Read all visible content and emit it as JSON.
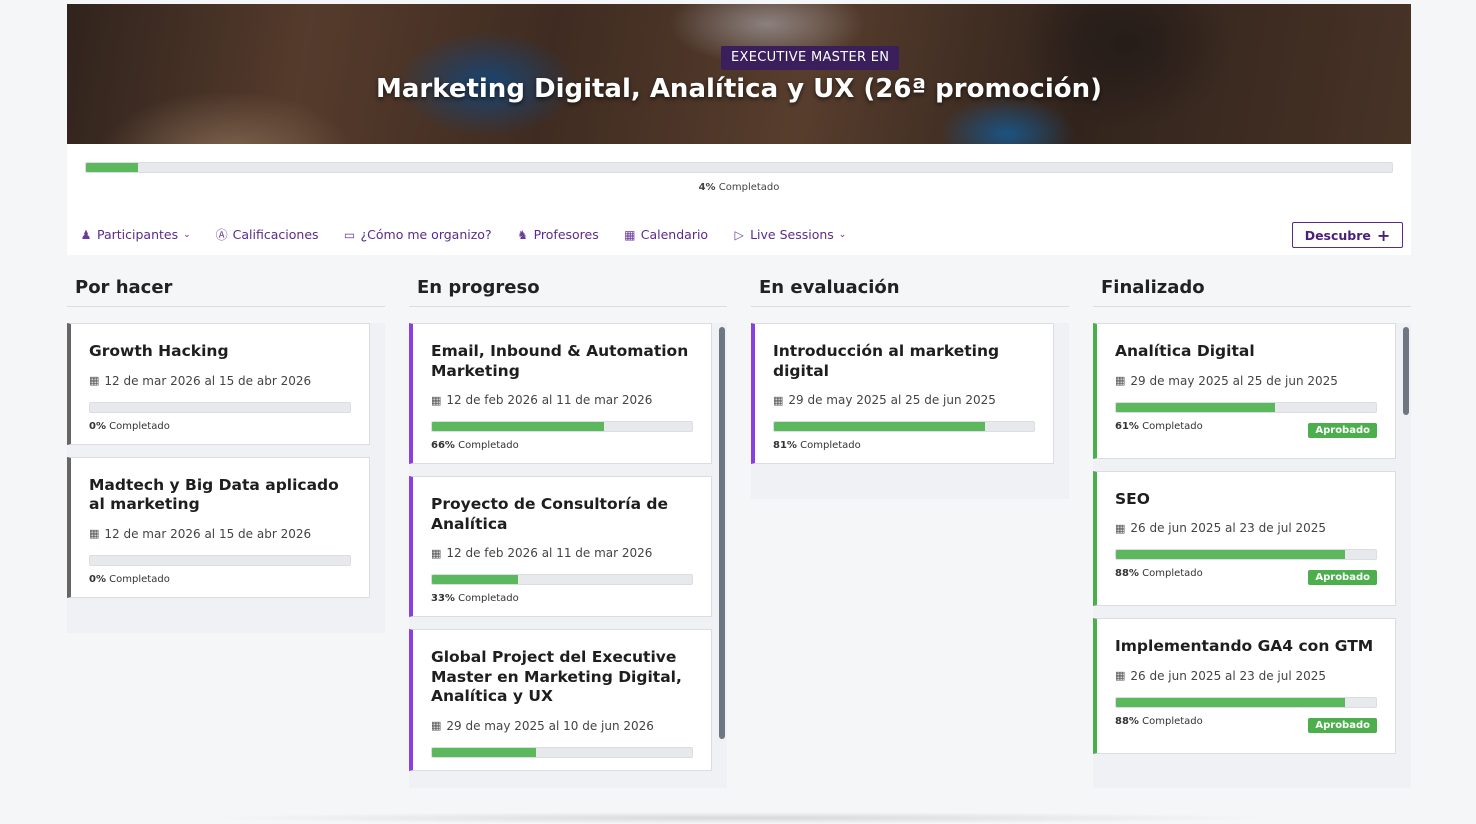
{
  "hero": {
    "badge": "EXECUTIVE MASTER EN",
    "title": "Marketing Digital, Analítica y UX (26ª promoción)"
  },
  "progress": {
    "percent": 4,
    "percent_label": "4%",
    "suffix": "Completado"
  },
  "nav": {
    "items": [
      {
        "label": "Participantes",
        "icon": "users-icon",
        "dropdown": true
      },
      {
        "label": "Calificaciones",
        "icon": "grade-icon",
        "dropdown": false
      },
      {
        "label": "¿Cómo me organizo?",
        "icon": "laptop-icon",
        "dropdown": false
      },
      {
        "label": "Profesores",
        "icon": "teacher-icon",
        "dropdown": false
      },
      {
        "label": "Calendario",
        "icon": "calendar-icon",
        "dropdown": false
      },
      {
        "label": "Live Sessions",
        "icon": "video-icon",
        "dropdown": true
      }
    ],
    "cta_label": "Descubre"
  },
  "columns": [
    {
      "title": "Por hacer",
      "cards": [
        {
          "title": "Growth Hacking",
          "date": "12 de mar 2026 al 15 de abr 2026",
          "percent": 0,
          "percent_label": "0%",
          "suffix": "Completado"
        },
        {
          "title": "Madtech y Big Data aplicado al marketing",
          "date": "12 de mar 2026 al 15 de abr 2026",
          "percent": 0,
          "percent_label": "0%",
          "suffix": "Completado"
        }
      ]
    },
    {
      "title": "En progreso",
      "cards": [
        {
          "title": "Email, Inbound & Automation Marketing",
          "date": "12 de feb 2026 al 11 de mar 2026",
          "percent": 66,
          "percent_label": "66%",
          "suffix": "Completado"
        },
        {
          "title": "Proyecto de Consultoría de Analítica",
          "date": "12 de feb 2026 al 11 de mar 2026",
          "percent": 33,
          "percent_label": "33%",
          "suffix": "Completado"
        },
        {
          "title": "Global Project del Executive Master en Marketing Digital, Analítica y UX",
          "date": "29 de may 2025 al 10 de jun 2026",
          "percent": 40,
          "percent_label": "",
          "suffix": ""
        }
      ]
    },
    {
      "title": "En evaluación",
      "cards": [
        {
          "title": "Introducción al marketing digital",
          "date": "29 de may 2025 al 25 de jun 2025",
          "percent": 81,
          "percent_label": "81%",
          "suffix": "Completado"
        }
      ]
    },
    {
      "title": "Finalizado",
      "cards": [
        {
          "title": "Analítica Digital",
          "date": "29 de may 2025 al 25 de jun 2025",
          "percent": 61,
          "percent_label": "61%",
          "suffix": "Completado",
          "badge": "Aprobado"
        },
        {
          "title": "SEO",
          "date": "26 de jun 2025 al 23 de jul 2025",
          "percent": 88,
          "percent_label": "88%",
          "suffix": "Completado",
          "badge": "Aprobado"
        },
        {
          "title": "Implementando GA4 con GTM",
          "date": "26 de jun 2025 al 23 de jul 2025",
          "percent": 88,
          "percent_label": "88%",
          "suffix": "Completado",
          "badge": "Aprobado"
        }
      ]
    }
  ],
  "colors": {
    "accent": "#5b2a8c",
    "success": "#5cb85c",
    "todo_border": "#666666",
    "progress_border": "#8a3fe0",
    "done_border": "#4cae4c"
  }
}
